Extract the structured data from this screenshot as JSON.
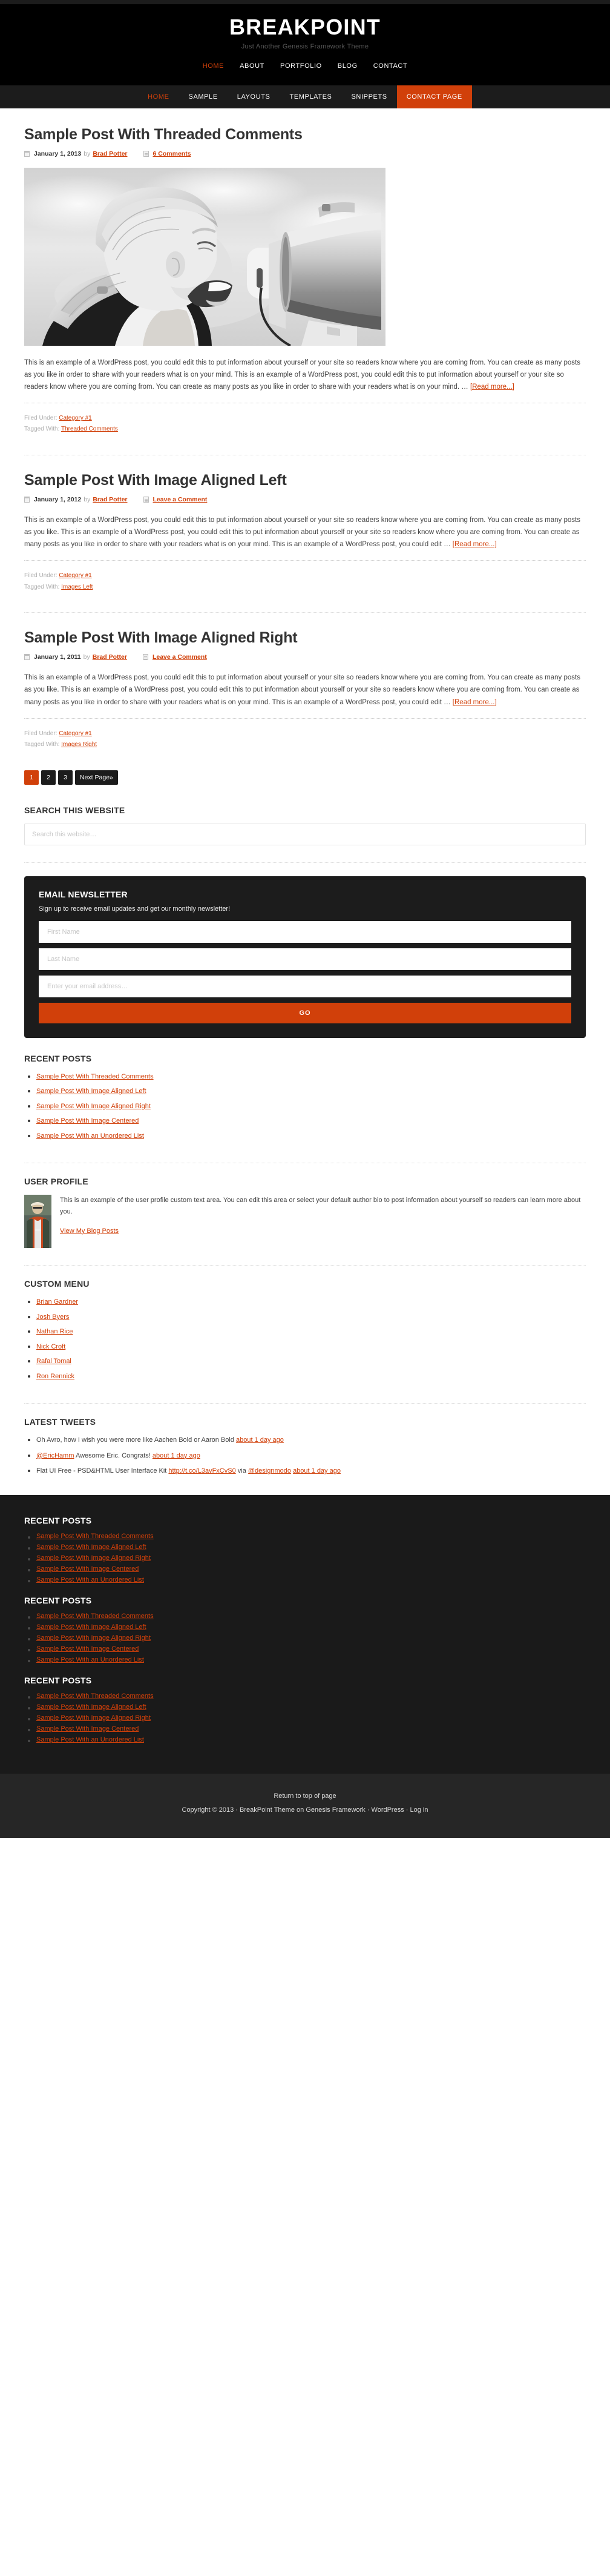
{
  "colors": {
    "accent": "#d1400a",
    "dark": "#1c1c1c",
    "black": "#000000",
    "footer_bg": "#262626",
    "footer_widgets_bg": "#1a1a1a"
  },
  "header": {
    "site_title": "BREAKPOINT",
    "site_description": "Just Another Genesis Framework Theme",
    "nav": [
      {
        "label": "HOME",
        "current": true
      },
      {
        "label": "ABOUT",
        "current": false
      },
      {
        "label": "PORTFOLIO",
        "current": false
      },
      {
        "label": "BLOG",
        "current": false
      },
      {
        "label": "CONTACT",
        "current": false
      }
    ]
  },
  "primary_nav": [
    {
      "label": "HOME",
      "state": "current"
    },
    {
      "label": "SAMPLE",
      "state": "normal"
    },
    {
      "label": "LAYOUTS",
      "state": "normal"
    },
    {
      "label": "TEMPLATES",
      "state": "normal"
    },
    {
      "label": "SNIPPETS",
      "state": "normal"
    },
    {
      "label": "CONTACT PAGE",
      "state": "highlight"
    }
  ],
  "posts": [
    {
      "title": "Sample Post With Threaded Comments",
      "date": "January 1, 2013",
      "by": "by",
      "author": "Brad Potter",
      "comments": "6 Comments",
      "has_image": true,
      "content": "This is an example of a WordPress post, you could edit this to put information about yourself or your site so readers know where you are coming from. You can create as many posts as you like in order to share with your readers what is on your mind. This is an example of a WordPress post, you could edit this to put information about yourself or your site so readers know where you are coming from. You can create as many posts as you like in order to share with your readers what is on your mind. … ",
      "read_more": "[Read more...]",
      "filed_under_label": "Filed Under:",
      "filed_under": "Category #1",
      "tagged_with_label": "Tagged With:",
      "tagged_with": "Threaded Comments"
    },
    {
      "title": "Sample Post With Image Aligned Left",
      "date": "January 1, 2012",
      "by": "by",
      "author": "Brad Potter",
      "comments": "Leave a Comment",
      "has_image": false,
      "content": "This is an example of a WordPress post, you could edit this to put information about yourself or your site so readers know where you are coming from. You can create as many posts as you like. This is an example of a WordPress post, you could edit this to put information about yourself or your site so readers know where you are coming from. You can create as many posts as you like in order to share with your readers what is on your mind. This is an example of a WordPress post, you could edit … ",
      "read_more": "[Read more...]",
      "filed_under_label": "Filed Under:",
      "filed_under": "Category #1",
      "tagged_with_label": "Tagged With:",
      "tagged_with": "Images Left"
    },
    {
      "title": "Sample Post With Image Aligned Right",
      "date": "January 1, 2011",
      "by": "by",
      "author": "Brad Potter",
      "comments": "Leave a Comment",
      "has_image": false,
      "content": "This is an example of a WordPress post, you could edit this to put information about yourself or your site so readers know where you are coming from. You can create as many posts as you like. This is an example of a WordPress post, you could edit this to put information about yourself or your site so readers know where you are coming from. You can create as many posts as you like in order to share with your readers what is on your mind. This is an example of a WordPress post, you could edit … ",
      "read_more": "[Read more...]",
      "filed_under_label": "Filed Under:",
      "filed_under": "Category #1",
      "tagged_with_label": "Tagged With:",
      "tagged_with": "Images Right"
    }
  ],
  "pagination": {
    "pages": [
      "1",
      "2",
      "3"
    ],
    "active": "1",
    "next_label": "Next Page»"
  },
  "search_widget": {
    "title": "SEARCH THIS WEBSITE",
    "placeholder": "Search this website…"
  },
  "enews": {
    "title": "EMAIL NEWSLETTER",
    "description": "Sign up to receive email updates and get our monthly newsletter!",
    "first_name_placeholder": "First Name",
    "last_name_placeholder": "Last Name",
    "email_placeholder": "Enter your email address…",
    "submit_label": "GO"
  },
  "recent_posts_widget": {
    "title": "RECENT POSTS",
    "items": [
      "Sample Post With Threaded Comments",
      "Sample Post With Image Aligned Left",
      "Sample Post With Image Aligned Right",
      "Sample Post With Image Centered",
      "Sample Post With an Unordered List"
    ]
  },
  "user_profile": {
    "title": "USER PROFILE",
    "bio": "This is an example of the user profile custom text area. You can edit this area or select your default author bio to post information about yourself so readers can learn more about you.",
    "link_label": "View My Blog Posts"
  },
  "custom_menu": {
    "title": "CUSTOM MENU",
    "items": [
      "Brian Gardner",
      "Josh Byers",
      "Nathan Rice",
      "Nick Croft",
      "Rafal Tomal",
      "Ron Rennick"
    ]
  },
  "latest_tweets": {
    "title": "LATEST TWEETS",
    "items": [
      {
        "pre": "",
        "link1": "",
        "text": "Oh Avro, how I wish you were more like Aachen Bold or Aaron Bold ",
        "time": "about 1 day ago",
        "mid": "",
        "link2": "",
        "post": ""
      },
      {
        "pre": "",
        "link1": "@EricHamm",
        "text": " Awesome Eric. Congrats! ",
        "time": "about 1 day ago",
        "mid": "",
        "link2": "",
        "post": ""
      },
      {
        "pre": "Flat UI Free - PSD&HTML User Interface Kit ",
        "link1": "http://t.co/L3avFxCvS0",
        "text": " via ",
        "link2": "@designmodo",
        "mid": " ",
        "time": "about 1 day ago",
        "post": ""
      }
    ]
  },
  "footer_widgets": [
    {
      "title": "RECENT POSTS",
      "items": [
        "Sample Post With Threaded Comments",
        "Sample Post With Image Aligned Left",
        "Sample Post With Image Aligned Right",
        "Sample Post With Image Centered",
        "Sample Post With an Unordered List"
      ]
    },
    {
      "title": "RECENT POSTS",
      "items": [
        "Sample Post With Threaded Comments",
        "Sample Post With Image Aligned Left",
        "Sample Post With Image Aligned Right",
        "Sample Post With Image Centered",
        "Sample Post With an Unordered List"
      ]
    },
    {
      "title": "RECENT POSTS",
      "items": [
        "Sample Post With Threaded Comments",
        "Sample Post With Image Aligned Left",
        "Sample Post With Image Aligned Right",
        "Sample Post With Image Centered",
        "Sample Post With an Unordered List"
      ]
    }
  ],
  "site_footer": {
    "return_to_top": "Return to top of page",
    "copyright_prefix": "Copyright © 2013 · ",
    "theme_link": "BreakPoint Theme",
    "on_text": " on ",
    "framework_link": "Genesis Framework",
    "sep1": " · ",
    "wordpress_link": "WordPress",
    "sep2": " · ",
    "login_link": "Log in"
  }
}
